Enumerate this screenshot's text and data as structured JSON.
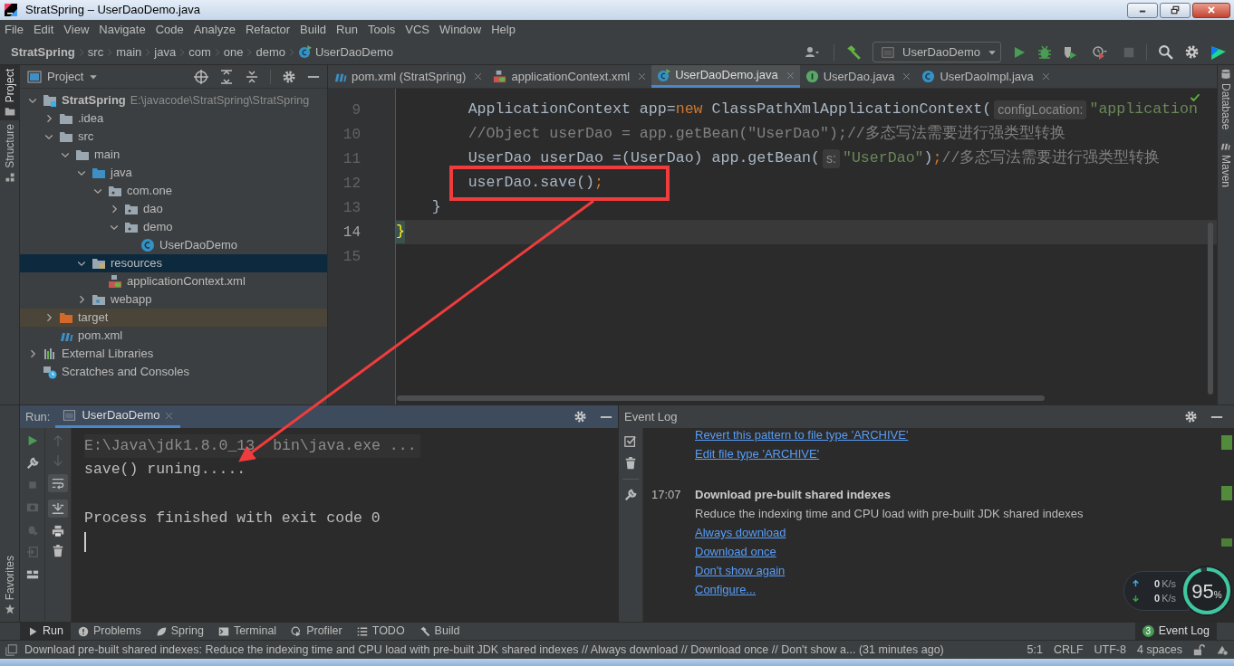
{
  "window": {
    "title": "StratSpring – UserDaoDemo.java"
  },
  "menu": [
    "File",
    "Edit",
    "View",
    "Navigate",
    "Code",
    "Analyze",
    "Refactor",
    "Build",
    "Run",
    "Tools",
    "VCS",
    "Window",
    "Help"
  ],
  "breadcrumbs": [
    {
      "label": "StratSpring",
      "kind": "project"
    },
    {
      "label": "src",
      "kind": "plain"
    },
    {
      "label": "main",
      "kind": "plain"
    },
    {
      "label": "java",
      "kind": "plain"
    },
    {
      "label": "com",
      "kind": "plain"
    },
    {
      "label": "one",
      "kind": "plain"
    },
    {
      "label": "demo",
      "kind": "plain"
    },
    {
      "label": "UserDaoDemo",
      "kind": "class"
    }
  ],
  "toolbar": {
    "run_config": "UserDaoDemo"
  },
  "left_strip": [
    {
      "label": "Project",
      "selected": true,
      "kind": "project"
    },
    {
      "label": "Structure",
      "selected": false,
      "kind": "structure"
    }
  ],
  "favorites": "Favorites",
  "project_panel": {
    "title": "Project",
    "tree": [
      {
        "label": "StratSpring",
        "path": "E:\\javacode\\StratSpring\\StratSpring",
        "kind": "module",
        "expanded": true,
        "selected": false,
        "children": [
          {
            "label": ".idea",
            "kind": "folder",
            "expanded": false,
            "selected": false
          },
          {
            "label": "src",
            "kind": "folder",
            "expanded": true,
            "selected": false,
            "children": [
              {
                "label": "main",
                "kind": "folder",
                "expanded": true,
                "selected": false,
                "children": [
                  {
                    "label": "java",
                    "kind": "source",
                    "expanded": true,
                    "selected": false,
                    "children": [
                      {
                        "label": "com.one",
                        "kind": "package",
                        "expanded": true,
                        "selected": false,
                        "children": [
                          {
                            "label": "dao",
                            "kind": "package",
                            "expanded": false,
                            "selected": false
                          },
                          {
                            "label": "demo",
                            "kind": "package",
                            "expanded": true,
                            "selected": false,
                            "children": [
                              {
                                "label": "UserDaoDemo",
                                "kind": "class",
                                "selected": false
                              }
                            ]
                          }
                        ]
                      }
                    ]
                  },
                  {
                    "label": "resources",
                    "kind": "resources",
                    "expanded": true,
                    "selected": true,
                    "children": [
                      {
                        "label": "applicationContext.xml",
                        "kind": "xml",
                        "selected": false
                      }
                    ]
                  },
                  {
                    "label": "webapp",
                    "kind": "web",
                    "expanded": false,
                    "selected": false
                  }
                ]
              }
            ]
          },
          {
            "label": "target",
            "kind": "excluded",
            "expanded": false,
            "selected": false
          },
          {
            "label": "pom.xml",
            "kind": "maven",
            "selected": false
          }
        ]
      },
      {
        "label": "External Libraries",
        "kind": "libraries",
        "expanded": false,
        "selected": false
      },
      {
        "label": "Scratches and Consoles",
        "kind": "scratches",
        "selected": false
      }
    ]
  },
  "editor": {
    "tabs": [
      {
        "label": "pom.xml (StratSpring)",
        "kind": "maven",
        "selected": false
      },
      {
        "label": "applicationContext.xml",
        "kind": "xml",
        "selected": false
      },
      {
        "label": "UserDaoDemo.java",
        "kind": "class-run",
        "selected": true
      },
      {
        "label": "UserDao.java",
        "kind": "interface",
        "selected": false
      },
      {
        "label": "UserDaoImpl.java",
        "kind": "class",
        "selected": false
      }
    ],
    "lines": [
      {
        "number": "9",
        "current": false,
        "segments": [
          {
            "kind": "plain",
            "text": "        ApplicationContext app="
          },
          {
            "kind": "keyword",
            "text": "new"
          },
          {
            "kind": "plain",
            "text": " ClassPathXmlApplicationContext("
          },
          {
            "kind": "hint",
            "text": "configLocation:"
          },
          {
            "kind": "string",
            "text": "\"application"
          }
        ]
      },
      {
        "number": "10",
        "current": false,
        "segments": [
          {
            "kind": "comment",
            "text": "        //Object userDao = app.getBean(\"UserDao\");//多态写法需要进行强类型转换"
          }
        ]
      },
      {
        "number": "11",
        "current": false,
        "segments": [
          {
            "kind": "plain",
            "text": "        UserDao userDao =(UserDao) app.getBean("
          },
          {
            "kind": "hint",
            "text": "s:"
          },
          {
            "kind": "string",
            "text": "\"UserDao\""
          },
          {
            "kind": "plain",
            "text": ")"
          },
          {
            "kind": "keyword",
            "text": ";"
          },
          {
            "kind": "comment",
            "text": "//多态写法需要进行强类型转换"
          }
        ]
      },
      {
        "number": "12",
        "current": false,
        "segments": [
          {
            "kind": "plain",
            "text": "        userDao.save()"
          },
          {
            "kind": "keyword",
            "text": ";"
          }
        ]
      },
      {
        "number": "13",
        "current": false,
        "segments": [
          {
            "kind": "plain",
            "text": "    }"
          }
        ]
      },
      {
        "number": "14",
        "current": true,
        "segments": [
          {
            "kind": "brace",
            "text": "}"
          }
        ]
      },
      {
        "number": "15",
        "current": false
      }
    ]
  },
  "right_strip": [
    "Database",
    "Maven"
  ],
  "run_panel": {
    "label": "Run:",
    "tabs": [
      {
        "label": "UserDaoDemo",
        "selected": true
      }
    ],
    "console": [
      {
        "kind": "command",
        "parts": [
          "E:\\Java\\jdk1.8.0_13",
          "bin\\java.exe ..."
        ]
      },
      {
        "kind": "output",
        "text": "save() runing....."
      },
      {
        "kind": "exit",
        "text": "Process finished with exit code 0"
      }
    ]
  },
  "event_log": {
    "title": "Event Log",
    "entries": [
      {
        "links": [
          "Revert this pattern to file type 'ARCHIVE'",
          "Edit file type 'ARCHIVE'"
        ]
      },
      {
        "time": "17:07",
        "title": "Download pre-built shared indexes",
        "text": "Reduce the indexing time and CPU load with pre-built JDK shared indexes",
        "links": [
          "Always download",
          "Download once",
          "Don't show again",
          "Configure..."
        ]
      }
    ]
  },
  "net_widget": {
    "up": "0",
    "up_unit": "K/s",
    "down": "0",
    "down_unit": "K/s",
    "percent": "95",
    "sign": "%",
    "level": 0.95
  },
  "tool_windows": [
    {
      "label": "Run",
      "kind": "run",
      "selected": true
    },
    {
      "label": "Problems",
      "kind": "problems",
      "selected": false
    },
    {
      "label": "Spring",
      "kind": "spring",
      "selected": false
    },
    {
      "label": "Terminal",
      "kind": "terminal",
      "selected": false
    },
    {
      "label": "Profiler",
      "kind": "profiler",
      "selected": false
    },
    {
      "label": "TODO",
      "kind": "todo",
      "selected": false
    },
    {
      "label": "Build",
      "kind": "build",
      "selected": false
    }
  ],
  "event_log_button": {
    "count": "3",
    "label": "Event Log"
  },
  "status_bar": {
    "message": "Download pre-built shared indexes: Reduce the indexing time and CPU load with pre-built JDK shared indexes // Always download // Download once // Don't show a... (31 minutes ago)",
    "items": [
      "5:1",
      "CRLF",
      "UTF-8",
      "4 spaces"
    ]
  }
}
